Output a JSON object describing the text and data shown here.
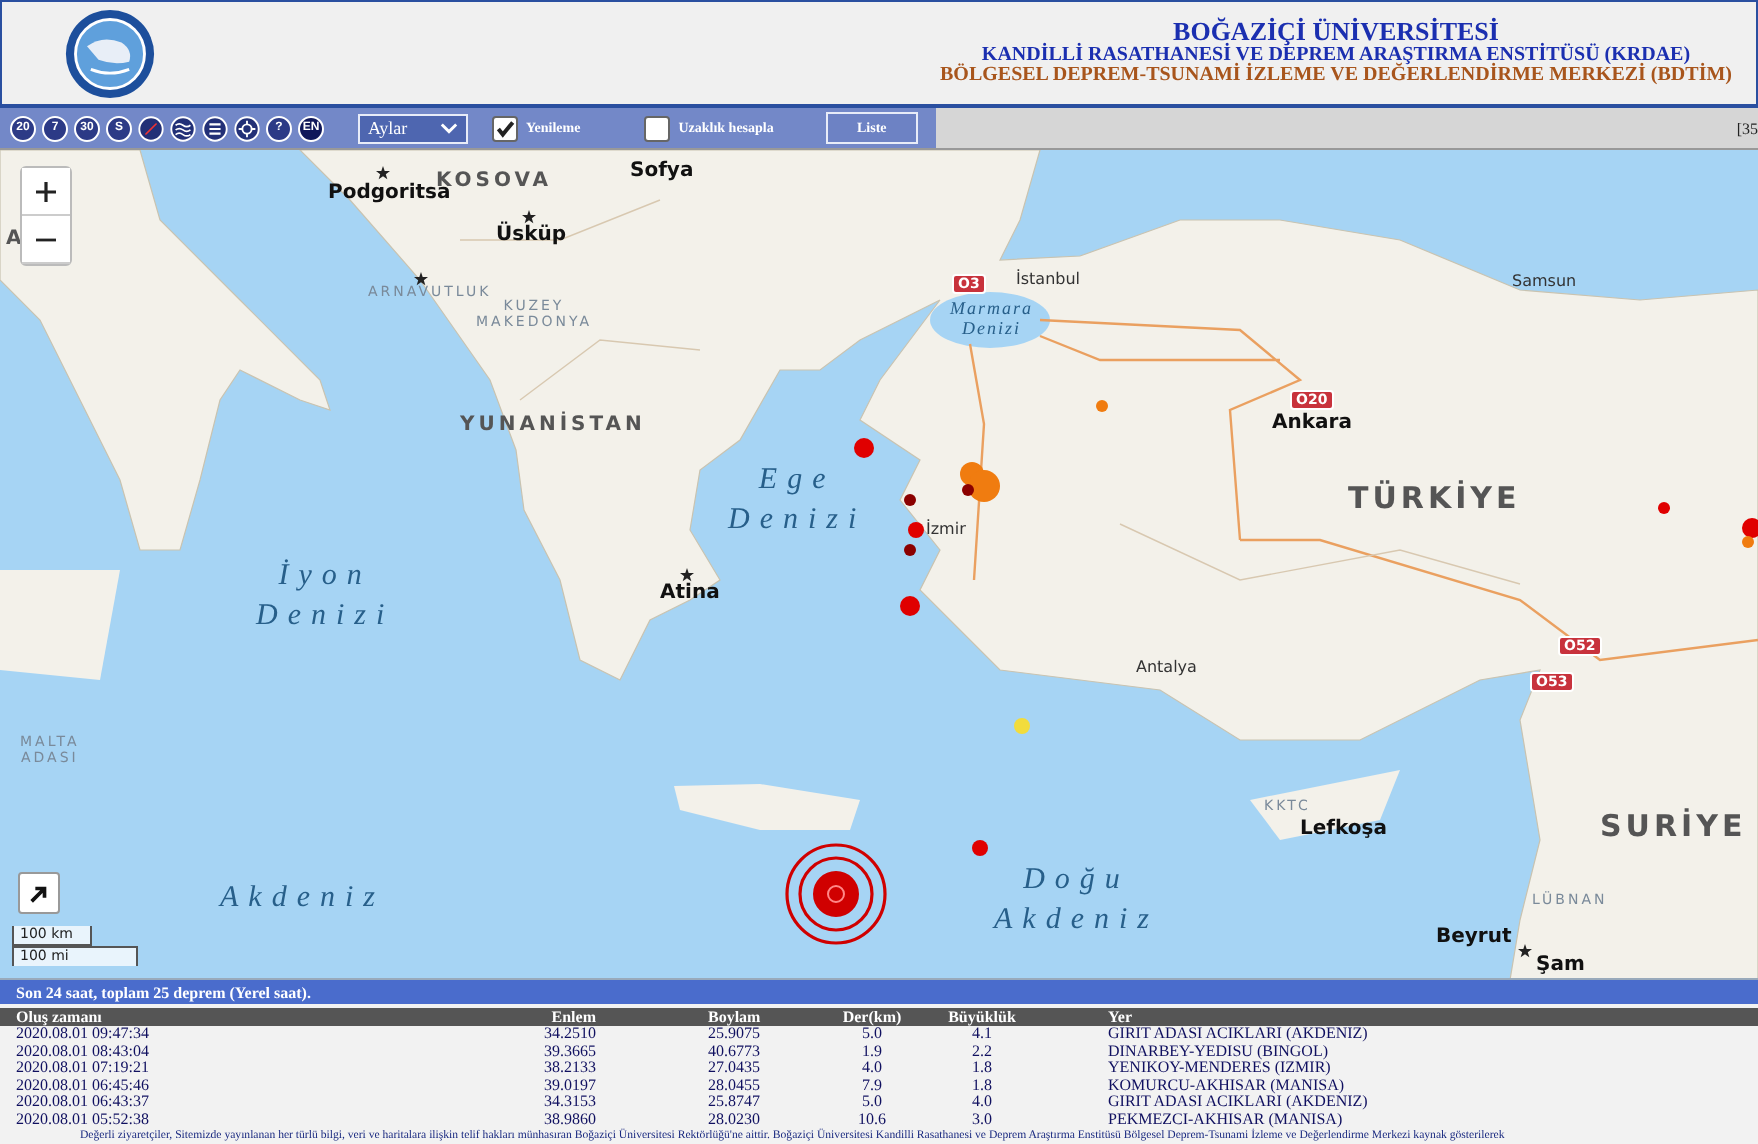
{
  "header": {
    "title": "BOĞAZİÇİ ÜNİVERSİTESİ",
    "subtitle": "KANDİLLİ RASATHANESİ VE DEPREM ARAŞTIRMA ENSTİTÜSÜ (KRDAE)",
    "center": "BÖLGESEL DEPREM-TSUNAMİ İZLEME VE DEĞERLENDİRME MERKEZİ (BDTİM)"
  },
  "toolbar": {
    "buttons": [
      {
        "kind": "text",
        "label": "20"
      },
      {
        "kind": "text",
        "label": "7"
      },
      {
        "kind": "text",
        "label": "30"
      },
      {
        "kind": "text",
        "label": "S"
      },
      {
        "kind": "icon"
      },
      {
        "kind": "icon"
      },
      {
        "kind": "icon"
      },
      {
        "kind": "icon"
      },
      {
        "kind": "text",
        "label": "?"
      },
      {
        "kind": "text",
        "label": "EN"
      }
    ],
    "period_select": {
      "value": "Aylar"
    },
    "checkboxes": [
      {
        "label": "Yenileme",
        "checked": true
      },
      {
        "label": "Uzaklık hesapla",
        "checked": false
      }
    ],
    "list_button": "Liste",
    "right_text": "[35"
  },
  "map": {
    "labels": [
      {
        "kind": "country",
        "text": "A"
      },
      {
        "kind": "country",
        "text": "KOSOVA"
      },
      {
        "kind": "city",
        "text": "Podgoritsa"
      },
      {
        "kind": "city",
        "text": "Sofya"
      },
      {
        "kind": "city",
        "text": "Üsküp"
      },
      {
        "kind": "region",
        "text": "ARNAVUTLUK"
      },
      {
        "kind": "region",
        "text": "KUZEY\nMAKEDONYA"
      },
      {
        "kind": "country",
        "text": "YUNANİSTAN"
      },
      {
        "kind": "sea",
        "text": "Ege\nDenizi"
      },
      {
        "kind": "sea",
        "text": "İyon\nDenizi"
      },
      {
        "kind": "city",
        "text": "Atina"
      },
      {
        "kind": "region",
        "text": "MALTA\nADASI"
      },
      {
        "kind": "sea",
        "text": "Akdeniz"
      },
      {
        "kind": "sea",
        "text": "Doğu\nAkdeniz"
      },
      {
        "kind": "road",
        "text": "O3"
      },
      {
        "kind": "town",
        "text": "İstanbul"
      },
      {
        "kind": "smallsea",
        "text": "Marmara\nDenizi"
      },
      {
        "kind": "town",
        "text": "Samsun"
      },
      {
        "kind": "road",
        "text": "O20"
      },
      {
        "kind": "city",
        "text": "Ankara"
      },
      {
        "kind": "bigcountry",
        "text": "TÜRKİYE"
      },
      {
        "kind": "town",
        "text": "İzmir"
      },
      {
        "kind": "road",
        "text": "O52"
      },
      {
        "kind": "road",
        "text": "O53"
      },
      {
        "kind": "town",
        "text": "Antalya"
      },
      {
        "kind": "region",
        "text": "KKTC"
      },
      {
        "kind": "city",
        "text": "Lefkoşa"
      },
      {
        "kind": "bigcountry",
        "text": "SURİYE"
      },
      {
        "kind": "region",
        "text": "LÜBNAN"
      },
      {
        "kind": "city",
        "text": "Beyrut"
      },
      {
        "kind": "city",
        "text": "Şam"
      }
    ],
    "quakes": [
      {
        "kind": "dot",
        "color": "#e00000"
      },
      {
        "kind": "dot",
        "color": "#8b0000"
      },
      {
        "kind": "dot",
        "color": "#e00000"
      },
      {
        "kind": "dot",
        "color": "#f07c10"
      },
      {
        "kind": "dot",
        "color": "#f07c10"
      },
      {
        "kind": "dot",
        "color": "#8b0000"
      },
      {
        "kind": "dot",
        "color": "#8b0000"
      },
      {
        "kind": "dot",
        "color": "#e00000"
      },
      {
        "kind": "dot",
        "color": "#f07c10"
      },
      {
        "kind": "dot",
        "color": "#f2dc3c"
      },
      {
        "kind": "dot",
        "color": "#e00000"
      },
      {
        "kind": "dot",
        "color": "#e00000"
      },
      {
        "kind": "dot",
        "color": "#e00000"
      },
      {
        "kind": "dot",
        "color": "#f07c10"
      },
      {
        "kind": "latest",
        "color": "#d00000"
      }
    ],
    "scale": [
      "100 km",
      "100 mi"
    ]
  },
  "status_bar": "Son 24 saat, toplam 25 deprem (Yerel saat).",
  "table": {
    "columns": [
      "Oluş zamanı",
      "Enlem",
      "Boylam",
      "Der(km)",
      "Büyüklük",
      "Yer"
    ],
    "rows": [
      [
        "2020.08.01 09:47:34",
        "34.2510",
        "25.9075",
        "5.0",
        "4.1",
        "GIRIT ADASI ACIKLARI (AKDENIZ)"
      ],
      [
        "2020.08.01 08:43:04",
        "39.3665",
        "40.6773",
        "1.9",
        "2.2",
        "DINARBEY-YEDISU (BINGOL)"
      ],
      [
        "2020.08.01 07:19:21",
        "38.2133",
        "27.0435",
        "4.0",
        "1.8",
        "YENIKOY-MENDERES (IZMIR)"
      ],
      [
        "2020.08.01 06:45:46",
        "39.0197",
        "28.0455",
        "7.9",
        "1.8",
        "KOMURCU-AKHISAR (MANISA)"
      ],
      [
        "2020.08.01 06:43:37",
        "34.3153",
        "25.8747",
        "5.0",
        "4.0",
        "GIRIT ADASI ACIKLARI (AKDENIZ)"
      ],
      [
        "2020.08.01 05:52:38",
        "38.9860",
        "28.0230",
        "10.6",
        "3.0",
        "PEKMEZCI-AKHISAR (MANISA)"
      ]
    ]
  },
  "footer": "Değerli ziyaretçiler, Sitemizde yayınlanan her türlü bilgi, veri ve haritalara ilişkin telif hakları münhasıran Boğaziçi Üniversitesi Rektörlüğü'ne aittir. Boğaziçi Üniversitesi Kandilli Rasathanesi ve Deprem Araştırma Enstitüsü Bölgesel Deprem-Tsunami İzleme ve Değerlendirme Merkezi kaynak gösterilerek"
}
